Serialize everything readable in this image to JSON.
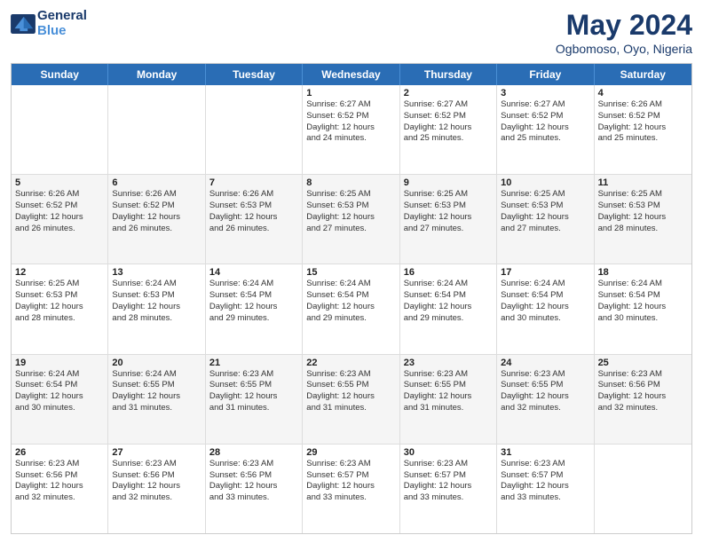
{
  "header": {
    "logo_general": "General",
    "logo_blue": "Blue",
    "month": "May 2024",
    "location": "Ogbomoso, Oyo, Nigeria"
  },
  "days": [
    "Sunday",
    "Monday",
    "Tuesday",
    "Wednesday",
    "Thursday",
    "Friday",
    "Saturday"
  ],
  "rows": [
    [
      {
        "date": "",
        "info": ""
      },
      {
        "date": "",
        "info": ""
      },
      {
        "date": "",
        "info": ""
      },
      {
        "date": "1",
        "info": "Sunrise: 6:27 AM\nSunset: 6:52 PM\nDaylight: 12 hours\nand 24 minutes."
      },
      {
        "date": "2",
        "info": "Sunrise: 6:27 AM\nSunset: 6:52 PM\nDaylight: 12 hours\nand 25 minutes."
      },
      {
        "date": "3",
        "info": "Sunrise: 6:27 AM\nSunset: 6:52 PM\nDaylight: 12 hours\nand 25 minutes."
      },
      {
        "date": "4",
        "info": "Sunrise: 6:26 AM\nSunset: 6:52 PM\nDaylight: 12 hours\nand 25 minutes."
      }
    ],
    [
      {
        "date": "5",
        "info": "Sunrise: 6:26 AM\nSunset: 6:52 PM\nDaylight: 12 hours\nand 26 minutes."
      },
      {
        "date": "6",
        "info": "Sunrise: 6:26 AM\nSunset: 6:52 PM\nDaylight: 12 hours\nand 26 minutes."
      },
      {
        "date": "7",
        "info": "Sunrise: 6:26 AM\nSunset: 6:53 PM\nDaylight: 12 hours\nand 26 minutes."
      },
      {
        "date": "8",
        "info": "Sunrise: 6:25 AM\nSunset: 6:53 PM\nDaylight: 12 hours\nand 27 minutes."
      },
      {
        "date": "9",
        "info": "Sunrise: 6:25 AM\nSunset: 6:53 PM\nDaylight: 12 hours\nand 27 minutes."
      },
      {
        "date": "10",
        "info": "Sunrise: 6:25 AM\nSunset: 6:53 PM\nDaylight: 12 hours\nand 27 minutes."
      },
      {
        "date": "11",
        "info": "Sunrise: 6:25 AM\nSunset: 6:53 PM\nDaylight: 12 hours\nand 28 minutes."
      }
    ],
    [
      {
        "date": "12",
        "info": "Sunrise: 6:25 AM\nSunset: 6:53 PM\nDaylight: 12 hours\nand 28 minutes."
      },
      {
        "date": "13",
        "info": "Sunrise: 6:24 AM\nSunset: 6:53 PM\nDaylight: 12 hours\nand 28 minutes."
      },
      {
        "date": "14",
        "info": "Sunrise: 6:24 AM\nSunset: 6:54 PM\nDaylight: 12 hours\nand 29 minutes."
      },
      {
        "date": "15",
        "info": "Sunrise: 6:24 AM\nSunset: 6:54 PM\nDaylight: 12 hours\nand 29 minutes."
      },
      {
        "date": "16",
        "info": "Sunrise: 6:24 AM\nSunset: 6:54 PM\nDaylight: 12 hours\nand 29 minutes."
      },
      {
        "date": "17",
        "info": "Sunrise: 6:24 AM\nSunset: 6:54 PM\nDaylight: 12 hours\nand 30 minutes."
      },
      {
        "date": "18",
        "info": "Sunrise: 6:24 AM\nSunset: 6:54 PM\nDaylight: 12 hours\nand 30 minutes."
      }
    ],
    [
      {
        "date": "19",
        "info": "Sunrise: 6:24 AM\nSunset: 6:54 PM\nDaylight: 12 hours\nand 30 minutes."
      },
      {
        "date": "20",
        "info": "Sunrise: 6:24 AM\nSunset: 6:55 PM\nDaylight: 12 hours\nand 31 minutes."
      },
      {
        "date": "21",
        "info": "Sunrise: 6:23 AM\nSunset: 6:55 PM\nDaylight: 12 hours\nand 31 minutes."
      },
      {
        "date": "22",
        "info": "Sunrise: 6:23 AM\nSunset: 6:55 PM\nDaylight: 12 hours\nand 31 minutes."
      },
      {
        "date": "23",
        "info": "Sunrise: 6:23 AM\nSunset: 6:55 PM\nDaylight: 12 hours\nand 31 minutes."
      },
      {
        "date": "24",
        "info": "Sunrise: 6:23 AM\nSunset: 6:55 PM\nDaylight: 12 hours\nand 32 minutes."
      },
      {
        "date": "25",
        "info": "Sunrise: 6:23 AM\nSunset: 6:56 PM\nDaylight: 12 hours\nand 32 minutes."
      }
    ],
    [
      {
        "date": "26",
        "info": "Sunrise: 6:23 AM\nSunset: 6:56 PM\nDaylight: 12 hours\nand 32 minutes."
      },
      {
        "date": "27",
        "info": "Sunrise: 6:23 AM\nSunset: 6:56 PM\nDaylight: 12 hours\nand 32 minutes."
      },
      {
        "date": "28",
        "info": "Sunrise: 6:23 AM\nSunset: 6:56 PM\nDaylight: 12 hours\nand 33 minutes."
      },
      {
        "date": "29",
        "info": "Sunrise: 6:23 AM\nSunset: 6:57 PM\nDaylight: 12 hours\nand 33 minutes."
      },
      {
        "date": "30",
        "info": "Sunrise: 6:23 AM\nSunset: 6:57 PM\nDaylight: 12 hours\nand 33 minutes."
      },
      {
        "date": "31",
        "info": "Sunrise: 6:23 AM\nSunset: 6:57 PM\nDaylight: 12 hours\nand 33 minutes."
      },
      {
        "date": "",
        "info": ""
      }
    ]
  ]
}
